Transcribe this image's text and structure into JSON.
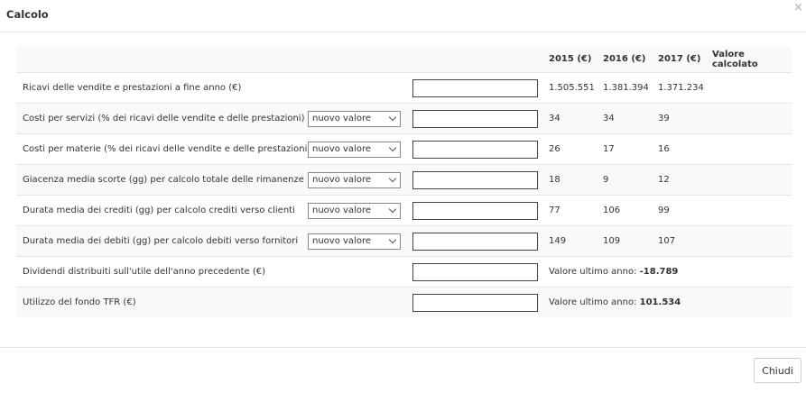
{
  "modal": {
    "title": "Calcolo",
    "close_icon": "×",
    "close_button_label": "Chiudi"
  },
  "table": {
    "headers": [
      "2015 (€)",
      "2016 (€)",
      "2017 (€)",
      "Valore calcolato"
    ],
    "select_value": "nuovo valore",
    "rows": [
      {
        "label": "Ricavi delle vendite e prestazioni a fine anno (€)",
        "has_select": false,
        "v2015": "1.505.551",
        "v2016": "1.381.394",
        "v2017": "1.371.234"
      },
      {
        "label": "Costi per servizi (% dei ricavi delle vendite e delle prestazioni)",
        "has_select": true,
        "v2015": "34",
        "v2016": "34",
        "v2017": "39"
      },
      {
        "label": "Costi per materie (% dei ricavi delle vendite e delle prestazioni)",
        "has_select": true,
        "v2015": "26",
        "v2016": "17",
        "v2017": "16"
      },
      {
        "label": "Giacenza media scorte (gg) per calcolo totale delle rimanenze",
        "has_select": true,
        "v2015": "18",
        "v2016": "9",
        "v2017": "12"
      },
      {
        "label": "Durata media dei crediti (gg) per calcolo crediti verso clienti",
        "has_select": true,
        "v2015": "77",
        "v2016": "106",
        "v2017": "99"
      },
      {
        "label": "Durata media dei debiti (gg) per calcolo debiti verso fornitori",
        "has_select": true,
        "v2015": "149",
        "v2016": "109",
        "v2017": "107"
      },
      {
        "label": "Dividendi distribuiti sull'utile dell'anno precedente (€)",
        "has_select": false,
        "last_year_prefix": "Valore ultimo anno: ",
        "last_year_value": "-18.789"
      },
      {
        "label": "Utilizzo del fondo TFR (€)",
        "has_select": false,
        "last_year_prefix": "Valore ultimo anno: ",
        "last_year_value": "101.534"
      }
    ]
  }
}
